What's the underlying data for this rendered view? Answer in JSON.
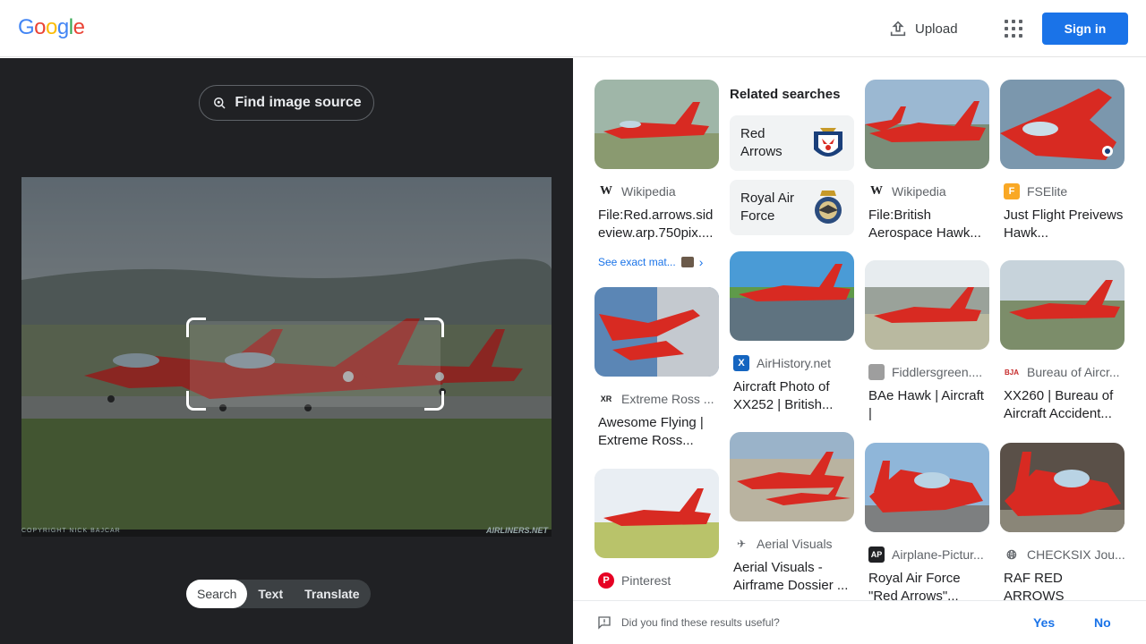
{
  "header": {
    "logo": [
      "G",
      "o",
      "o",
      "g",
      "l",
      "e"
    ],
    "logo_colors": [
      "#4285F4",
      "#EA4335",
      "#FBBC05",
      "#4285F4",
      "#34A853",
      "#EA4335"
    ],
    "upload_label": "Upload",
    "signin_label": "Sign in"
  },
  "lens": {
    "find_source_label": "Find image source",
    "watermark_left": "COPYRIGHT NICK BAJCAR",
    "watermark_right": "AIRLINERS.NET",
    "tabs": [
      {
        "label": "Search",
        "active": true
      },
      {
        "label": "Text",
        "active": false
      },
      {
        "label": "Translate",
        "active": false
      }
    ]
  },
  "results": {
    "col1": [
      {
        "source": "Wikipedia",
        "fav": "W",
        "fav_color": "#ffffff",
        "title": "File:Red.arrows.sideview.arp.750pix....",
        "see_exact": "See exact mat..."
      },
      {
        "source": "Extreme Ross ...",
        "fav": "XR",
        "fav_color": "#ffffff",
        "title": "Awesome Flying | Extreme Ross..."
      },
      {
        "source": "Pinterest",
        "fav": "P",
        "fav_color": "#e60023",
        "title": ""
      }
    ],
    "related_title": "Related searches",
    "related": [
      {
        "label": "Red Arrows"
      },
      {
        "label": "Royal Air Force"
      }
    ],
    "col2": [
      {
        "source": "AirHistory.net",
        "fav": "X",
        "fav_color": "#1565c0",
        "title": "Aircraft Photo of XX252 | British..."
      },
      {
        "source": "Aerial Visuals",
        "fav": "",
        "fav_color": "#ffffff",
        "title": "Aerial Visuals - Airframe Dossier ..."
      }
    ],
    "col3": [
      {
        "source": "Wikipedia",
        "fav": "W",
        "fav_color": "#ffffff",
        "title": "File:British Aerospace Hawk..."
      },
      {
        "source": "Fiddlersgreen....",
        "fav": "",
        "fav_color": "#9e9e9e",
        "title": "BAe Hawk | Aircraft |"
      },
      {
        "source": "Airplane-Pictur...",
        "fav": "AP",
        "fav_color": "#202124",
        "title": "Royal Air Force \"Red Arrows\"..."
      }
    ],
    "col4": [
      {
        "source": "FSElite",
        "fav": "F",
        "fav_color": "#f9a825",
        "title": "Just Flight Preivews Hawk..."
      },
      {
        "source": "Bureau of Aircr...",
        "fav": "BJA",
        "fav_color": "#ffffff",
        "title": "XX260 | Bureau of Aircraft Accident..."
      },
      {
        "source": "CHECKSIX Jou...",
        "fav": "",
        "fav_color": "#ffffff",
        "title": "RAF RED ARROWS"
      }
    ]
  },
  "feedback": {
    "question": "Did you find these results useful?",
    "yes": "Yes",
    "no": "No"
  }
}
